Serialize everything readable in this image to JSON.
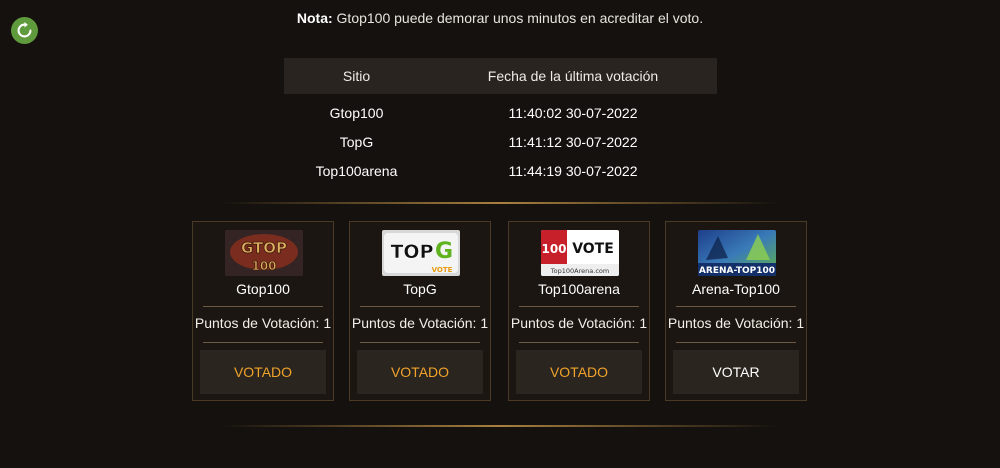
{
  "refresh": {
    "icon": "refresh-icon",
    "color": "#5f9a3c"
  },
  "note": {
    "label": "Nota:",
    "text": " Gtop100 puede demorar unos minutos en acreditar el voto."
  },
  "table": {
    "headers": {
      "site": "Sitio",
      "date": "Fecha de la última votación"
    },
    "rows": [
      {
        "site": "Gtop100",
        "date": "11:40:02 30-07-2022"
      },
      {
        "site": "TopG",
        "date": "11:41:12 30-07-2022"
      },
      {
        "site": "Top100arena",
        "date": "11:44:19 30-07-2022"
      }
    ]
  },
  "cards": [
    {
      "name": "Gtop100",
      "points": "Puntos de Votación: 1",
      "button": "VOTADO",
      "banner_text": [
        "GTOP",
        "100"
      ]
    },
    {
      "name": "TopG",
      "points": "Puntos de Votación: 1",
      "button": "VOTADO",
      "banner_text": [
        "TOP",
        "G",
        "VOTE"
      ]
    },
    {
      "name": "Top100arena",
      "points": "Puntos de Votación: 1",
      "button": "VOTADO",
      "banner_text": [
        "100",
        "VOTE",
        "Top100Arena.com"
      ]
    },
    {
      "name": "Arena-Top100",
      "points": "Puntos de Votación: 1",
      "button": "VOTAR",
      "banner_text": [
        "ARENA-TOP100"
      ]
    }
  ],
  "colors": {
    "background": "#15110e",
    "accent": "#f0a32a",
    "border": "#4a3a26",
    "button_bg": "#2b2520"
  }
}
